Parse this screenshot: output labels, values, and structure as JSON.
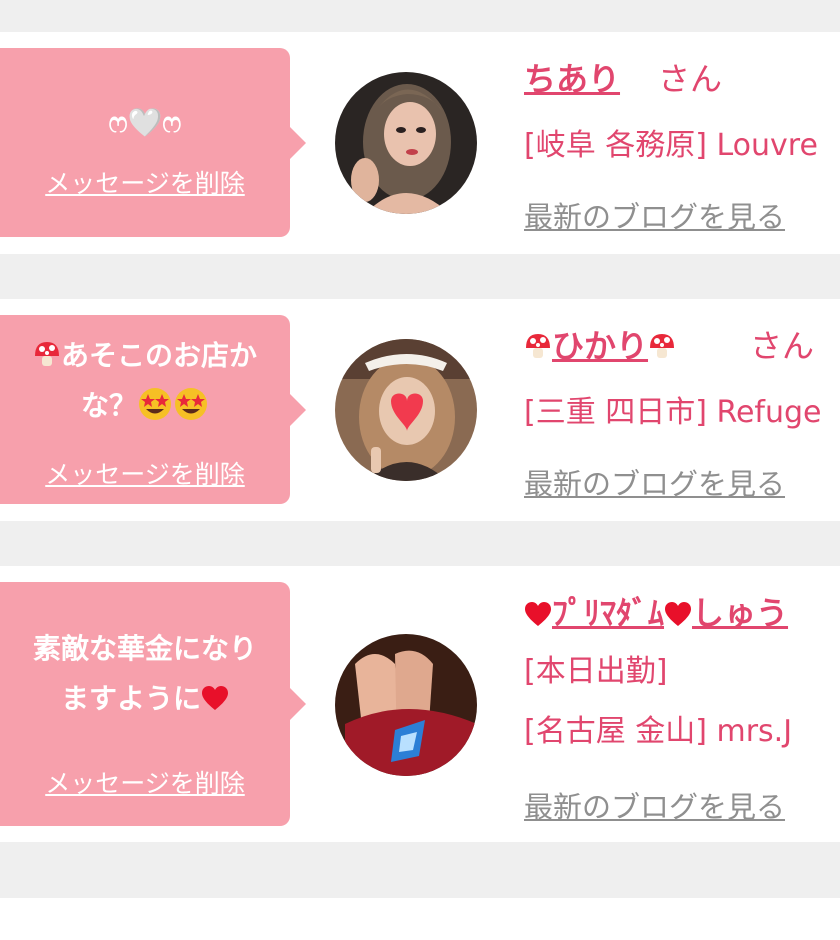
{
  "messages": [
    {
      "text_line1": "ෆ🤍ෆ",
      "text_line2": "",
      "delete_label": "メッセージを削除",
      "name": "ちあり",
      "honorific": "さん",
      "info_lines": [
        "[岐阜 各務原] Louvre"
      ],
      "blog_label": "最新のブログを見る"
    },
    {
      "text_line1": "あそこのお店か",
      "text_line2": "な？",
      "delete_label": "メッセージを削除",
      "name": "ひかり",
      "honorific": "さん",
      "info_lines": [
        "[三重 四日市] Refuge"
      ],
      "blog_label": "最新のブログを見る"
    },
    {
      "text_line1": "素敵な華金になり",
      "text_line2": "ますように",
      "delete_label": "メッセージを削除",
      "name_prefix": "ﾌﾟﾘﾏﾀﾞﾑ",
      "name": "しゅう",
      "honorific": "",
      "info_lines": [
        "[本日出勤]",
        "[名古屋 金山] mrs.J"
      ],
      "blog_label": "最新のブログを見る"
    }
  ],
  "colors": {
    "bubble": "#f7a0ac",
    "name": "#e1466e",
    "blog_link": "#8f8f8f",
    "background": "#efefef"
  },
  "icons": {
    "m1": "white-heart-emoji",
    "m2": [
      "mushroom-emoji",
      "star-struck-emoji"
    ],
    "m3": [
      "red-heart-emoji"
    ]
  }
}
